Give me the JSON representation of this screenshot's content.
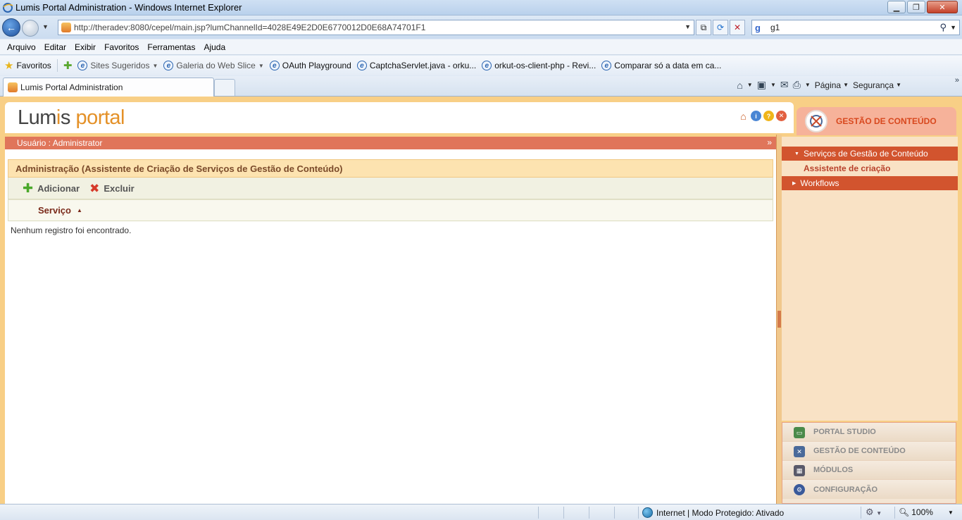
{
  "window": {
    "title": "Lumis Portal Administration - Windows Internet Explorer"
  },
  "address": {
    "url": "http://theradev:8080/cepel/main.jsp?lumChannelId=4028E49E2D0E6770012D0E68A74701F1",
    "search_value": "g1"
  },
  "menu": [
    "Arquivo",
    "Editar",
    "Exibir",
    "Favoritos",
    "Ferramentas",
    "Ajuda"
  ],
  "favorites": {
    "label": "Favoritos",
    "items": [
      {
        "label": "Sites Sugeridos",
        "dropdown": true
      },
      {
        "label": "Galeria do Web Slice",
        "dropdown": true
      },
      {
        "label": "OAuth Playground",
        "dropdown": false
      },
      {
        "label": "CaptchaServlet.java - orku...",
        "dropdown": false
      },
      {
        "label": "orkut-os-client-php - Revi...",
        "dropdown": false
      },
      {
        "label": "Comparar só a data em ca...",
        "dropdown": false
      }
    ]
  },
  "tab": {
    "label": "Lumis Portal Administration"
  },
  "commandbar": {
    "page_label": "Página",
    "security_label": "Segurança"
  },
  "portal": {
    "logo_part1": "Lum",
    "logo_i": "i",
    "logo_part2": "s",
    "logo_part3": "portal",
    "user_label": "Usuário : Administrator",
    "admin_title": "Administração (Assistente de Criação de Serviços de Gestão de Conteúdo)",
    "add_label": "Adicionar",
    "delete_label": "Excluir",
    "column_service": "Serviço",
    "empty_message": "Nenhum registro foi encontrado."
  },
  "sidebar": {
    "header_title": "GESTÃO DE CONTEÚDO",
    "items": [
      {
        "label": "Serviços de Gestão de Conteúdo"
      },
      {
        "label": "Assistente de criação"
      },
      {
        "label": "Workflows"
      }
    ],
    "modules": [
      {
        "label": "PORTAL STUDIO",
        "icon": "monitor-icon"
      },
      {
        "label": "GESTÃO DE CONTEÚDO",
        "icon": "content-icon"
      },
      {
        "label": "MÓDULOS",
        "icon": "modules-icon"
      },
      {
        "label": "CONFIGURAÇÃO",
        "icon": "config-icon"
      }
    ]
  },
  "status": {
    "zone": "Internet | Modo Protegido: Ativado",
    "zoom": "100%"
  },
  "colors": {
    "accent_orange": "#e49128",
    "bar_red": "#e0755a",
    "sidebar_selected": "#d2542e"
  }
}
